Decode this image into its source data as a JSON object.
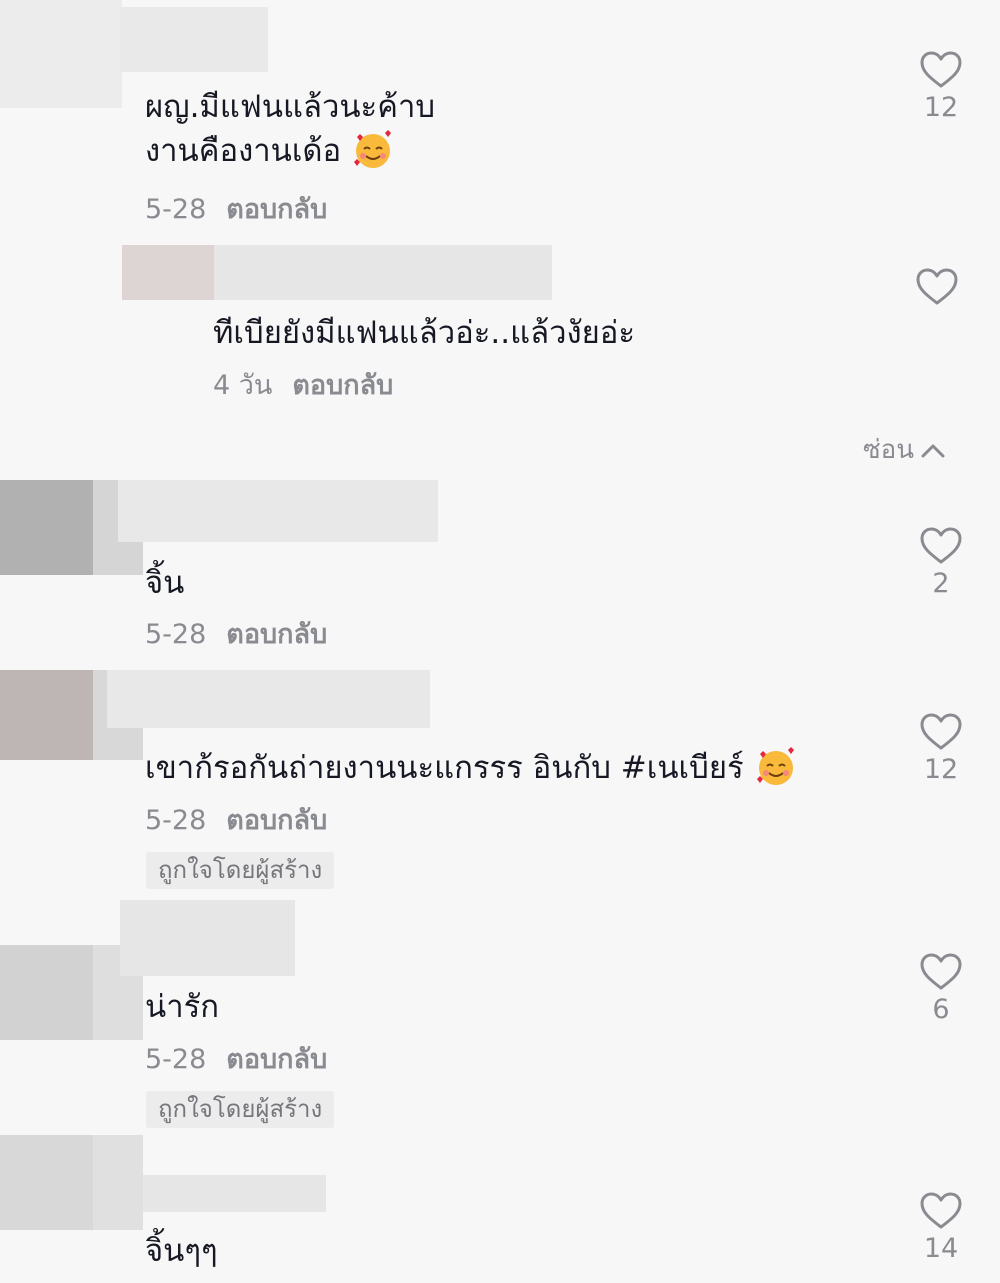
{
  "comments": [
    {
      "lines": [
        "ผญ.มีแฟนแล้วนะค้าบ",
        "งานคืองานเด้อ"
      ],
      "emoji": "smiling-face-with-hearts",
      "date": "5-28",
      "reply": "ตอบกลับ",
      "likes": "12"
    },
    {
      "lines": [
        "ทีเบียยังมีแฟนแล้วอ่ะ..แล้วงัยอ่ะ"
      ],
      "date": "4 วัน",
      "reply": "ตอบกลับ",
      "likes": ""
    },
    {
      "lines": [
        "จิ้น"
      ],
      "date": "5-28",
      "reply": "ตอบกลับ",
      "likes": "2"
    },
    {
      "lines": [
        "เขาก้รอกันถ่ายงานนะแกรรร อินกับ #เนเบียร์"
      ],
      "emoji": "smiling-face-with-hearts",
      "date": "5-28",
      "reply": "ตอบกลับ",
      "likes": "12",
      "badge": "ถูกใจโดยผู้สร้าง"
    },
    {
      "lines": [
        "น่ารัก"
      ],
      "date": "5-28",
      "reply": "ตอบกลับ",
      "likes": "6",
      "badge": "ถูกใจโดยผู้สร้าง"
    },
    {
      "lines": [
        "จิ้นๆๆ"
      ],
      "likes": "14"
    }
  ],
  "hide_replies": "ซ่อน",
  "colors": {
    "text": "#161823",
    "secondary": "#8a8b91",
    "background": "#f7f7f7",
    "badge_bg": "#ececec"
  },
  "icons": {
    "like": "heart-outline-icon",
    "hide": "chevron-up-icon",
    "emoji": "smiling-face-with-hearts"
  }
}
